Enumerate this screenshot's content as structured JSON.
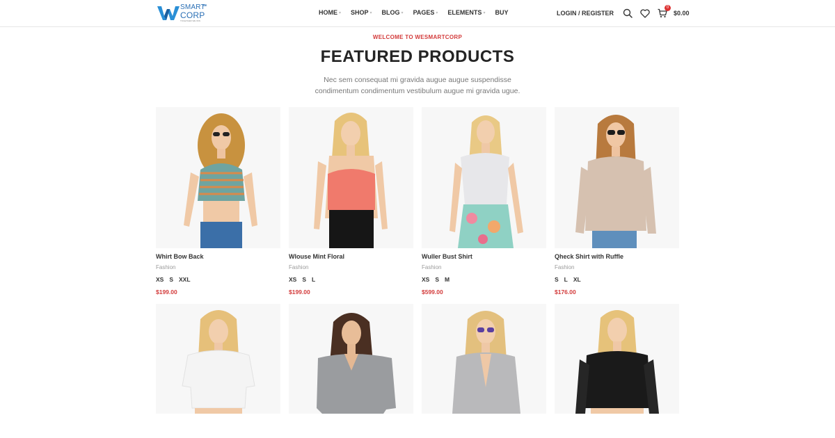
{
  "header": {
    "logo": {
      "line1": "SMART",
      "line2": "CORP",
      "tagline": "TOGETHER WE WIN",
      "mark": "WE"
    },
    "nav": [
      {
        "label": "HOME",
        "caret": true
      },
      {
        "label": "SHOP",
        "caret": true
      },
      {
        "label": "BLOG",
        "caret": true
      },
      {
        "label": "PAGES",
        "caret": true
      },
      {
        "label": "ELEMENTS",
        "caret": true
      },
      {
        "label": "BUY",
        "caret": false
      }
    ],
    "login_label": "LOGIN / REGISTER",
    "cart_count": "0",
    "cart_total": "$0.00"
  },
  "section": {
    "subtitle": "WELCOME TO WESMARTCORP",
    "title": "FEATURED PRODUCTS",
    "desc_line1": "Nec sem consequat mi gravida augue augue suspendisse",
    "desc_line2": "condimentum condimentum vestibulum augue mi gravida ugue."
  },
  "products": [
    {
      "name": "Whirt Bow Back",
      "category": "Fashion",
      "sizes": [
        "XS",
        "S",
        "XXL"
      ],
      "price": "$199.00"
    },
    {
      "name": "Wlouse Mint Floral",
      "category": "Fashion",
      "sizes": [
        "XS",
        "S",
        "L"
      ],
      "price": "$199.00"
    },
    {
      "name": "Wuller Bust Shirt",
      "category": "Fashion",
      "sizes": [
        "XS",
        "S",
        "M"
      ],
      "price": "$599.00"
    },
    {
      "name": "Qheck Shirt with Ruffle",
      "category": "Fashion",
      "sizes": [
        "S",
        "L",
        "XL"
      ],
      "price": "$176.00"
    }
  ],
  "colors": {
    "accent": "#d33b3b",
    "brand": "#2a6fb5",
    "image_bg": "#f7f7f7"
  },
  "icons": {
    "search": "search-icon",
    "wishlist": "heart-icon",
    "cart": "cart-icon"
  }
}
